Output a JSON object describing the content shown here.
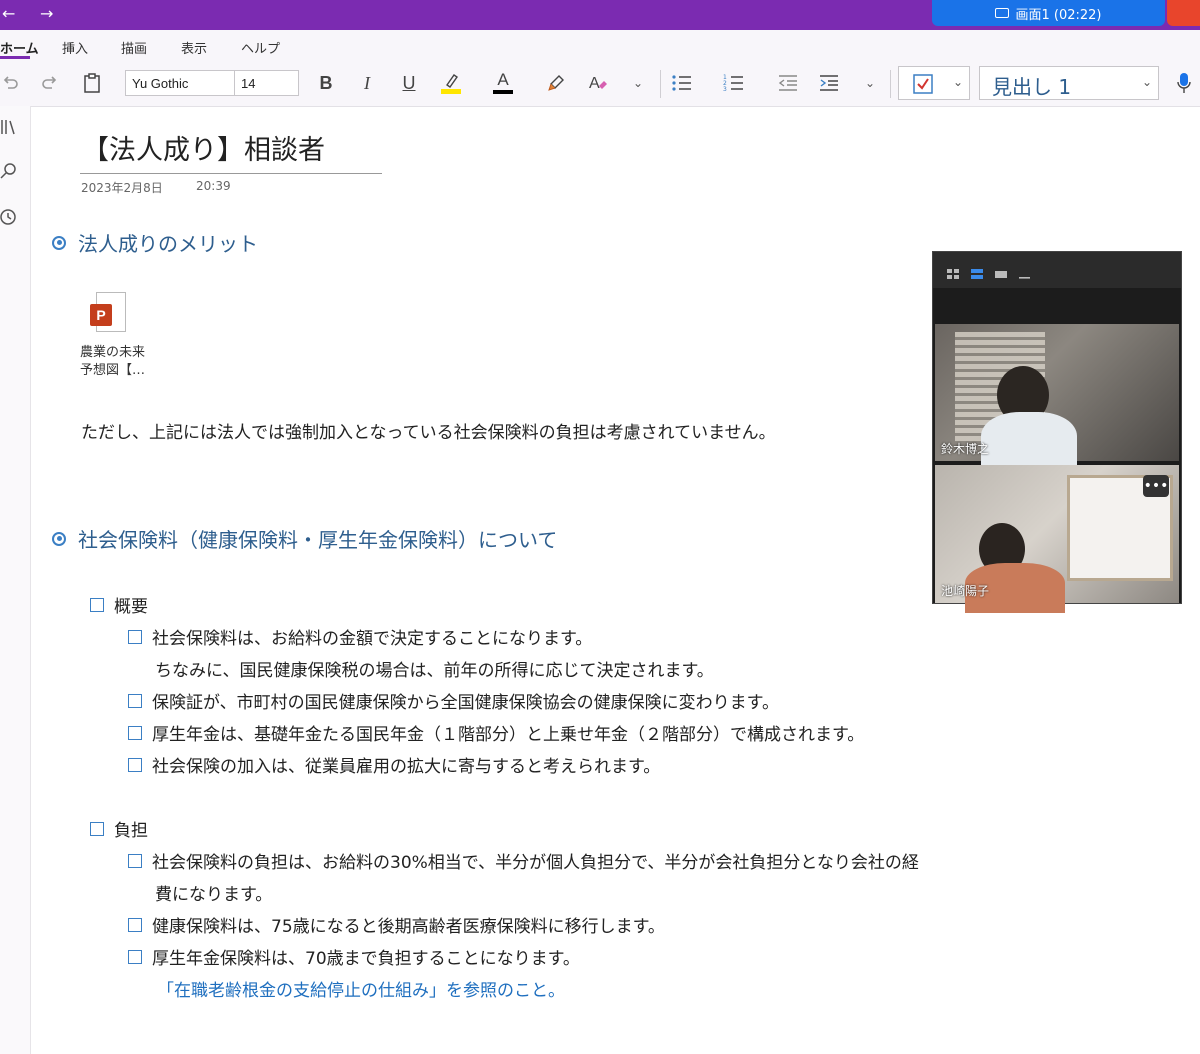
{
  "window": {
    "screen_share_label": "画面1 (02:22)",
    "back_icon": "←",
    "forward_icon": "→"
  },
  "ribbon": {
    "tabs": [
      {
        "label": "ホーム",
        "active": true
      },
      {
        "label": "挿入"
      },
      {
        "label": "描画"
      },
      {
        "label": "表示"
      },
      {
        "label": "ヘルプ"
      }
    ]
  },
  "toolbar": {
    "font_name": "Yu Gothic",
    "font_size": "14",
    "bold_label": "B",
    "italic_label": "I",
    "underline_label": "U",
    "font_color_label": "A",
    "style_label": "見出し 1",
    "highlight_color": "#ffe600",
    "font_color": "#000000"
  },
  "page": {
    "title": "【法人成り】相談者",
    "date": "2023年2月8日",
    "time": "20:39",
    "heading1": "法人成りのメリット",
    "attachment_line1": "農業の未来",
    "attachment_line2": "予想図【…",
    "paragraph": "ただし、上記には法人では強制加入となっている社会保険料の負担は考慮されていません。",
    "heading2": "社会保険料（健康保険料・厚生年金保険料）について",
    "overview": {
      "label": "概要",
      "items": [
        "社会保険料は、お給料の金額で決定することになります。",
        "保険証が、市町村の国民健康保険から全国健康保険協会の健康保険に変わります。",
        "厚生年金は、基礎年金たる国民年金（１階部分）と上乗せ年金（２階部分）で構成されます。",
        "社会保険の加入は、従業員雇用の拡大に寄与すると考えられます。"
      ],
      "continuation": "ちなみに、国民健康保険税の場合は、前年の所得に応じて決定されます。"
    },
    "burden": {
      "label": "負担",
      "items": [
        "社会保険料の負担は、お給料の30%相当で、半分が個人負担分で、半分が会社負担分となり会社の経",
        "健康保険料は、75歳になると後期高齢者医療保険料に移行します。",
        "厚生年金保険料は、70歳まで負担することになります。"
      ],
      "continuation": "費になります。",
      "link": "「在職老齢根金の支給停止の仕組み」を参照のこと。"
    }
  },
  "video": {
    "participant1": "鈴木博之",
    "participant2": "池崎陽子",
    "more_label": "•••"
  }
}
